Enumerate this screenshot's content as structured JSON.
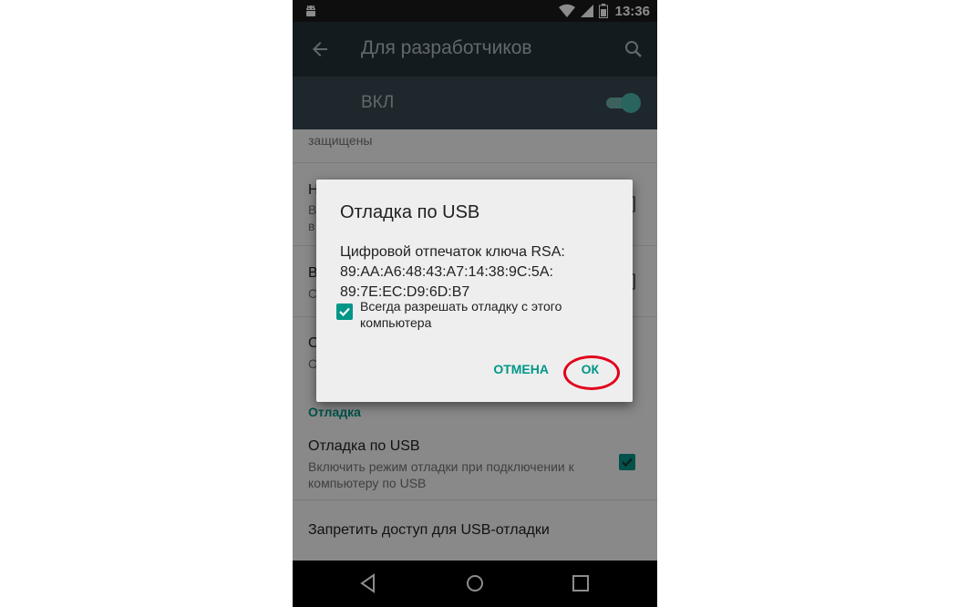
{
  "status_bar": {
    "time": "13:36"
  },
  "toolbar": {
    "title": "Для разработчиков"
  },
  "master_switch": {
    "label": "ВКЛ",
    "on": true
  },
  "list": {
    "partial_top_subtitle": "защищены",
    "item1": {
      "title_fragment": "Н",
      "subtitle_fragments": [
        "В",
        "в"
      ]
    },
    "item2": {
      "title_fragment": "В",
      "subtitle_fragment": "С"
    },
    "item3": {
      "title_fragment": "С",
      "subtitle_fragment": "С"
    },
    "section_debug": "Отладка",
    "usb_debug": {
      "title": "Отладка по USB",
      "subtitle": "Включить режим отладки при подключении к компьютеру по USB",
      "checked": true
    },
    "revoke_usb": {
      "title": "Запретить доступ для USB-отладки"
    }
  },
  "dialog": {
    "title": "Отладка по USB",
    "body_line1": "Цифровой отпечаток ключа RSA:",
    "body_line2": "89:AA:A6:48:43:A7:14:38:9C:5A:",
    "body_line3": "89:7E:EC:D9:6D:B7",
    "always_allow_label": "Всегда разрешать отладку с этого компьютера",
    "always_allow_checked": true,
    "cancel_label": "ОТМЕНА",
    "ok_label": "ОК"
  },
  "colors": {
    "accent": "#009688",
    "toolbar": "#263238",
    "highlight": "#e3001b"
  }
}
